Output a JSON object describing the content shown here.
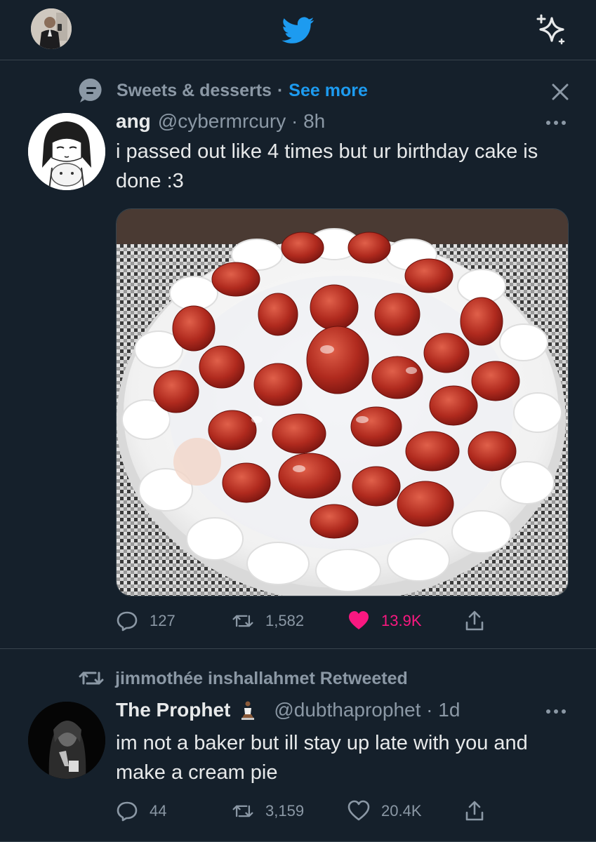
{
  "header": {
    "profile_icon": "profile-avatar",
    "logo_icon": "twitter-bird-icon",
    "sparkle_icon": "sparkle-icon"
  },
  "tweets": [
    {
      "context_icon": "topic-icon",
      "topic": "Sweets & desserts",
      "separator": "·",
      "see_more": "See more",
      "name": "ang",
      "handle": "@cybermrcury · 8h",
      "text": "i passed out like 4 times but ur birthday cake is done :3",
      "media_alt_icon": "cake-photo",
      "replies": "127",
      "retweets": "1,582",
      "likes": "13.9K",
      "liked": true
    },
    {
      "retweeted_by": "jimmothée inshallahmet Retweeted",
      "name": "The Prophet",
      "emoji_icon": "praying-person-icon",
      "handle": "@dubthaprophet · 1d",
      "text": "im not a baker but ill stay up late with you and make a cream pie",
      "replies": "44",
      "retweets": "3,159",
      "likes": "20.4K",
      "liked": false
    }
  ],
  "colors": {
    "background": "#15202b",
    "accent": "#1d9bf0",
    "like": "#f91880",
    "muted": "#8b98a5",
    "divider": "#38444d"
  }
}
